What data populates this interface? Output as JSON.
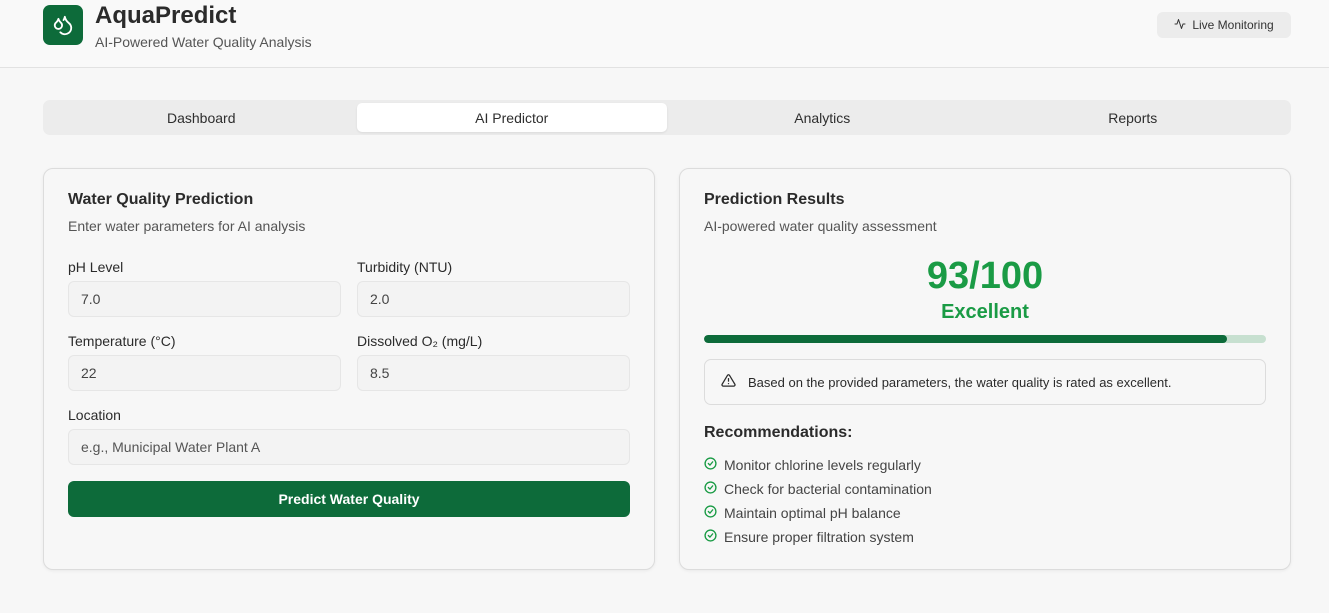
{
  "header": {
    "title": "AquaPredict",
    "subtitle": "AI-Powered Water Quality Analysis",
    "logo_icon": "droplets-icon",
    "live_label": "Live Monitoring",
    "live_icon": "activity-icon"
  },
  "tabs": [
    {
      "label": "Dashboard",
      "active": false
    },
    {
      "label": "AI Predictor",
      "active": true
    },
    {
      "label": "Analytics",
      "active": false
    },
    {
      "label": "Reports",
      "active": false
    }
  ],
  "form": {
    "title": "Water Quality Prediction",
    "subtitle": "Enter water parameters for AI analysis",
    "ph": {
      "label": "pH Level",
      "value": "7.0"
    },
    "turbidity": {
      "label": "Turbidity (NTU)",
      "value": "2.0"
    },
    "temperature": {
      "label": "Temperature (°C)",
      "value": "22"
    },
    "oxygen": {
      "label": "Dissolved O₂ (mg/L)",
      "value": "8.5"
    },
    "location": {
      "label": "Location",
      "value": "",
      "placeholder": "e.g., Municipal Water Plant A"
    },
    "submit_label": "Predict Water Quality"
  },
  "results": {
    "title": "Prediction Results",
    "subtitle": "AI-powered water quality assessment",
    "score_text": "93/100",
    "score_value": 93,
    "score_max": 100,
    "rating": "Excellent",
    "alert_icon": "alert-triangle-icon",
    "alert_text": "Based on the provided parameters, the water quality is rated as excellent.",
    "recommendations_title": "Recommendations:",
    "recommendations": [
      "Monitor chlorine levels regularly",
      "Check for bacterial contamination",
      "Maintain optimal pH balance",
      "Ensure proper filtration system"
    ]
  },
  "colors": {
    "brand": "#0d6b3a",
    "score": "#1a9b45",
    "bar_track": "#c7e0d0"
  }
}
